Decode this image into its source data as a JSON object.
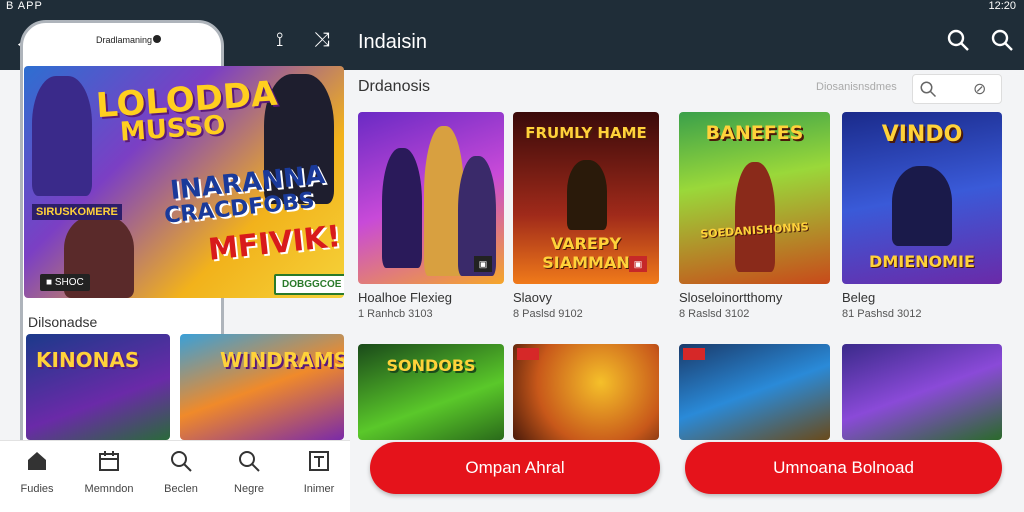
{
  "status": {
    "left": "B APP",
    "right": "12:20"
  },
  "appbar": {
    "title": "Indaisin"
  },
  "phone": {
    "notch_text": "Dradlamaning"
  },
  "hero": {
    "title_line1": "LOLODDA",
    "title_line2": "MUSSO",
    "big_line1": "INARANNA",
    "big_line2": "CRACDFOBS",
    "big_line3": "MFIVIK!",
    "tag": "SIRUSKOMERE",
    "chip": "■ SHOC",
    "badge": "DOBGGCOE"
  },
  "left_section": {
    "title": "Dilsonadse",
    "cards": [
      {
        "title": "KINONAS"
      },
      {
        "title": "WINDRAMS"
      }
    ]
  },
  "main": {
    "section_title": "Drdanosis",
    "section_sub": "Diosanisnsdmes",
    "games": [
      {
        "name": "Hoalhoe Flexieg",
        "meta": "1  Ranhcb 3103",
        "title": "",
        "sub": ""
      },
      {
        "name": "Slaovy",
        "meta": "8  Paslsd 9102",
        "title": "FRUMLY HAME",
        "sub": "VAREPY SIAMMAN"
      },
      {
        "name": "Sloseloinortthomy",
        "meta": "8  Raslsd 3102",
        "title": "BANEFES",
        "sub": "SOEDANISHONNS"
      },
      {
        "name": "Beleg",
        "meta": "81  Pashsd 3012",
        "title": "VINDO",
        "sub": "DMIENOMIE"
      }
    ],
    "row2": [
      {
        "title": "SONDOBS"
      },
      {
        "title": ""
      },
      {
        "title": ""
      },
      {
        "title": ""
      }
    ]
  },
  "bottomnav": {
    "items": [
      {
        "label": "Fudies",
        "icon": "home-icon"
      },
      {
        "label": "Memndon",
        "icon": "calendar-icon"
      },
      {
        "label": "Beclen",
        "icon": "search-icon"
      },
      {
        "label": "Negre",
        "icon": "search-icon"
      },
      {
        "label": "Inimer",
        "icon": "menu-box-icon"
      }
    ]
  },
  "actions": {
    "primary": "Ompan Ahral",
    "secondary": "Umnoana Bolnoad"
  },
  "colors": {
    "appbar": "#1f2d38",
    "accent": "#e5131b"
  }
}
